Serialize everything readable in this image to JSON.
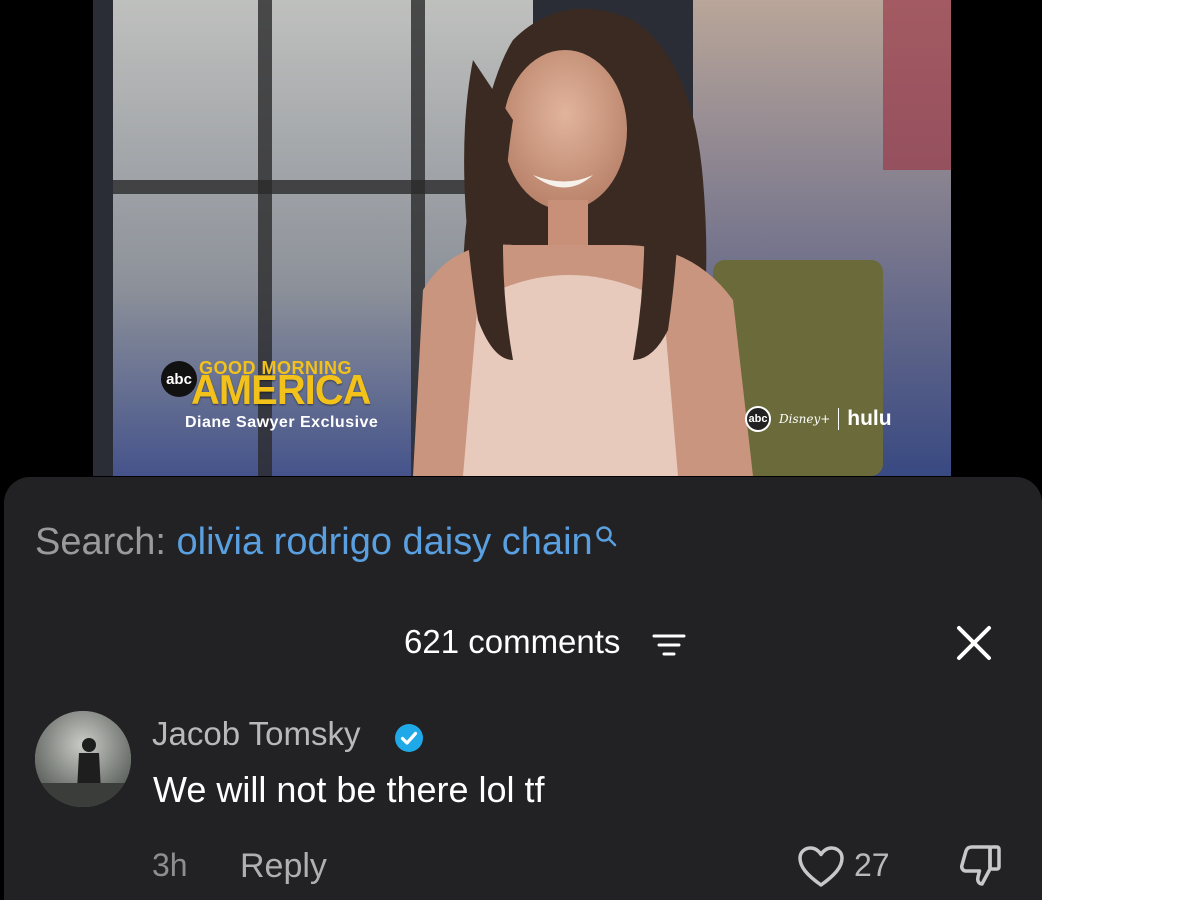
{
  "video": {
    "network_badge": "abc",
    "show_title_top": "GOOD MORNING",
    "show_title_main": "AMERICA",
    "show_subtitle": "Diane Sawyer Exclusive",
    "brand_abc": "abc",
    "brand_disney": "Disney+",
    "brand_hulu": "hulu"
  },
  "search": {
    "prefix": "Search: ",
    "query": "olivia rodrigo daisy chain"
  },
  "comments_header": {
    "count_label": "621 comments"
  },
  "comment": {
    "author": "Jacob Tomsky",
    "text": "We will not be there lol tf",
    "time": "3h",
    "reply_label": "Reply",
    "likes": "27"
  },
  "colors": {
    "sheet_bg": "#222224",
    "search_link": "#5a9fe0",
    "verified": "#20a9e8",
    "gma_yellow": "#f2c21b"
  }
}
